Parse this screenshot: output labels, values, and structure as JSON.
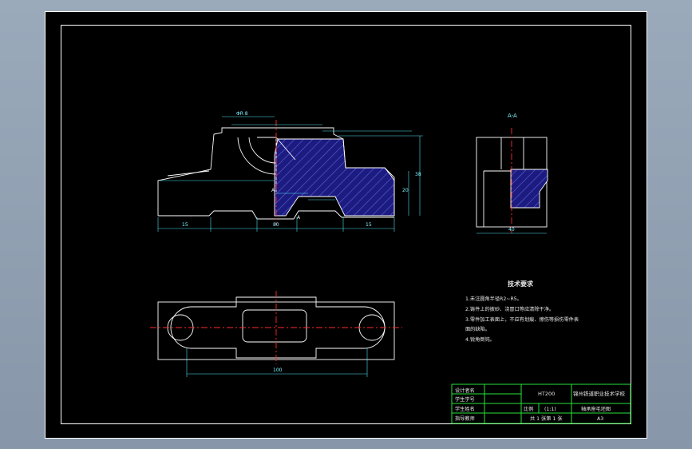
{
  "section_label": "A-A",
  "tech_requirements": {
    "title": "技术要求",
    "items": [
      "1.未注圆角半径R2~R5。",
      "2.铸件上的披砂、浇冒口等应清除干净。",
      "3.零件加工表面上，不应有划痕、擦伤等损伤零件表",
      "面的缺陷。",
      "4.锐角倒钝。"
    ]
  },
  "title_block": {
    "designer": "设计者名",
    "student_id": "学生学号",
    "student_name": "学生姓名",
    "advisor": "指导教师",
    "material": "HT200",
    "school": "锦州铁道职业技术学校",
    "scale_label": "比例",
    "scale_value": "(1:1)",
    "drawing_name": "轴承座毛坯图",
    "sheets": "共 1 张第 1 张",
    "size": "A3"
  },
  "dimensions": {
    "top_width": "ΦR 8",
    "front_bottom_left": "15",
    "front_bottom_mid": "80",
    "front_bottom_right": "15",
    "front_height": "38",
    "front_mid_height": "20",
    "side_width": "40",
    "top_overall": "100"
  },
  "colors": {
    "background": "#000000",
    "dimension": "#4fe0f2",
    "centerline": "#ff2a2a",
    "hatch": "#2a2aa0",
    "frame_green": "#27e23a"
  }
}
